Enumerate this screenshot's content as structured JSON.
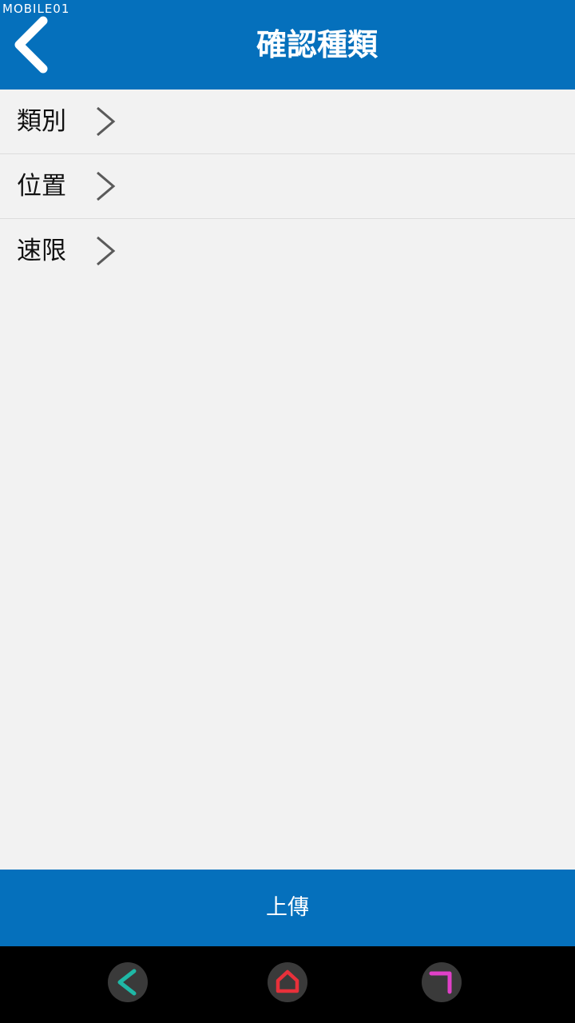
{
  "watermark": "MOBILE01",
  "header": {
    "title": "確認種類",
    "back_icon": "chevron-left-icon"
  },
  "list": {
    "items": [
      {
        "label": "類別",
        "icon": "chevron-right-icon"
      },
      {
        "label": "位置",
        "icon": "chevron-right-icon"
      },
      {
        "label": "速限",
        "icon": "chevron-right-icon"
      }
    ]
  },
  "footer": {
    "upload_label": "上傳"
  },
  "system_nav": {
    "back_icon": "back-icon",
    "home_icon": "home-icon",
    "recent_icon": "recent-apps-icon"
  },
  "colors": {
    "brand_blue": "#0570bc",
    "background": "#f2f2f2",
    "nav_back": "#1fb8a6",
    "nav_home": "#e8303a",
    "nav_recent": "#e040c8"
  }
}
